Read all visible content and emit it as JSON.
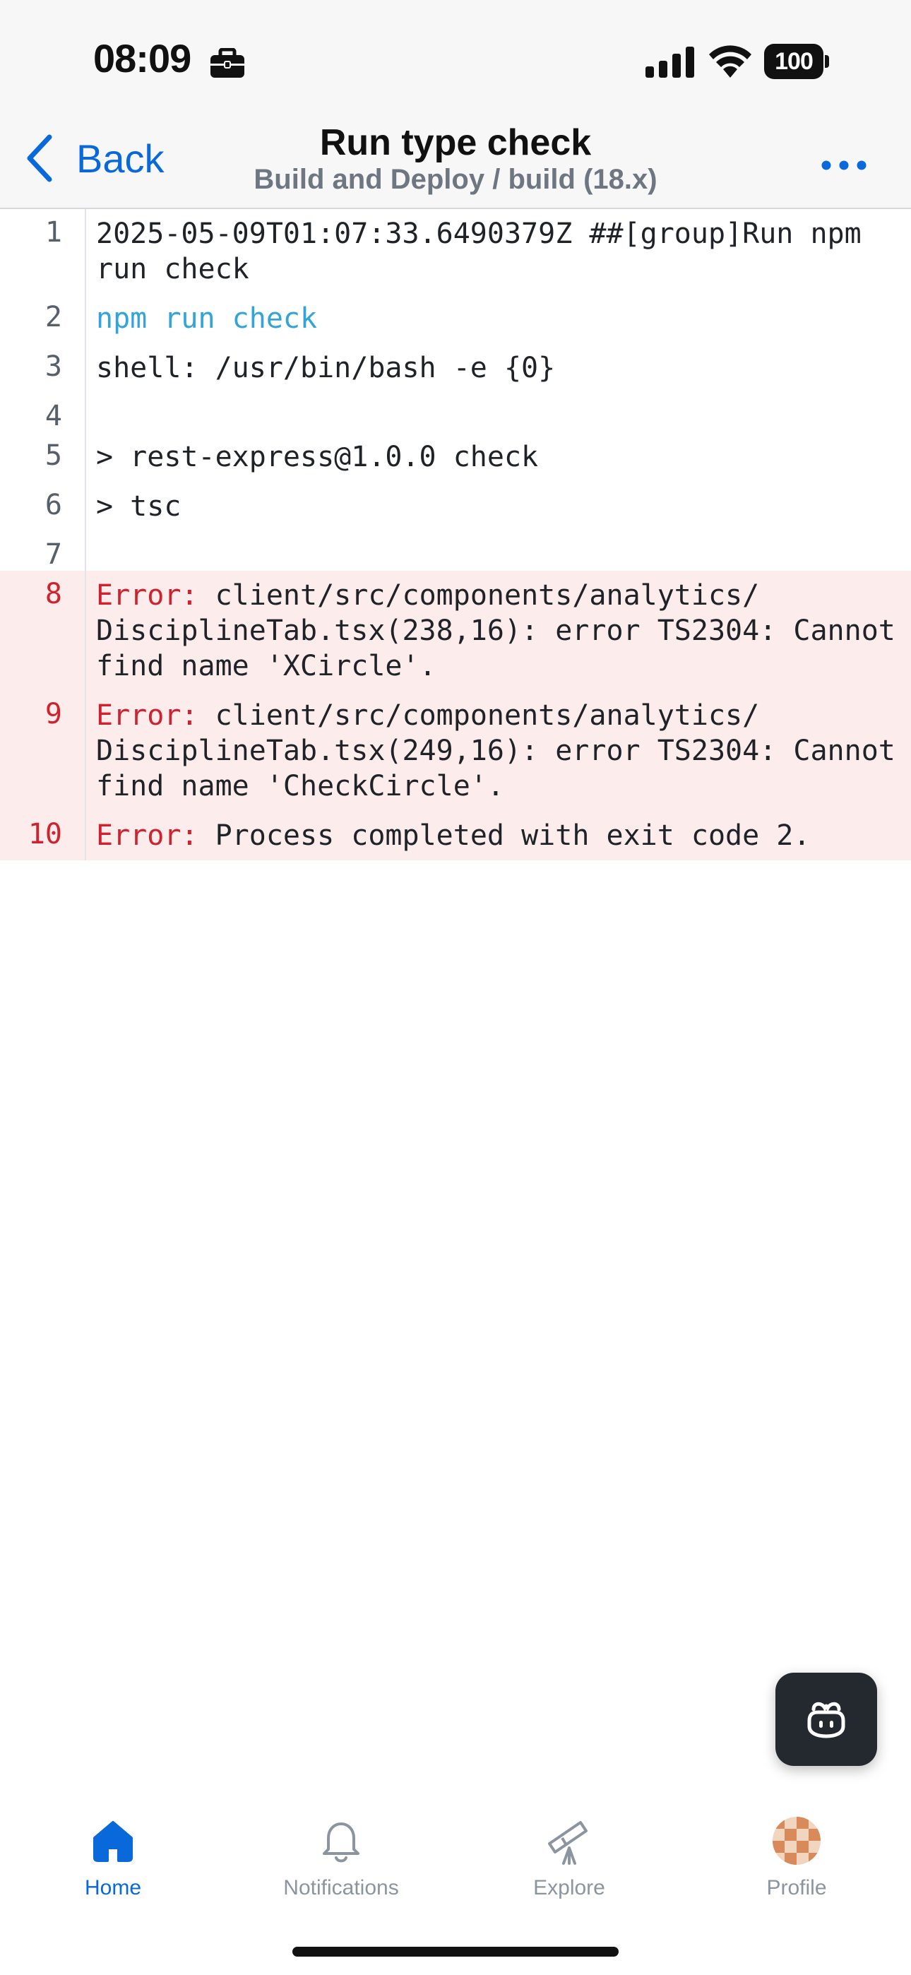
{
  "status_bar": {
    "time": "08:09",
    "battery": "100"
  },
  "nav": {
    "back_label": "Back",
    "title": "Run type check",
    "subtitle": "Build and Deploy / build (18.x)"
  },
  "log": [
    {
      "num": "1",
      "type": "normal",
      "text": "2025-05-09T01:07:33.6490379Z ##[group]Run npm run check"
    },
    {
      "num": "2",
      "type": "command",
      "text": "npm run check"
    },
    {
      "num": "3",
      "type": "normal",
      "text": "shell: /usr/bin/bash -e {0}"
    },
    {
      "num": "4",
      "type": "normal",
      "text": ""
    },
    {
      "num": "5",
      "type": "normal",
      "text": "> rest-express@1.0.0 check"
    },
    {
      "num": "6",
      "type": "normal",
      "text": "> tsc"
    },
    {
      "num": "7",
      "type": "normal",
      "text": ""
    },
    {
      "num": "8",
      "type": "error",
      "label": "Error:",
      "text": "client/src/components/analytics/ DisciplineTab.tsx(238,16): error TS2304: Cannot find name 'XCircle'."
    },
    {
      "num": "9",
      "type": "error",
      "label": "Error:",
      "text": "client/src/components/analytics/ DisciplineTab.tsx(249,16): error TS2304: Cannot find name 'CheckCircle'."
    },
    {
      "num": "10",
      "type": "error",
      "label": "Error:",
      "text": "Process completed with exit code 2."
    }
  ],
  "tabs": {
    "home": "Home",
    "notifications": "Notifications",
    "explore": "Explore",
    "profile": "Profile"
  },
  "colors": {
    "accent": "#0969da",
    "error": "#cf222e",
    "error_bg": "#fdecec",
    "command": "#33a4d8"
  }
}
